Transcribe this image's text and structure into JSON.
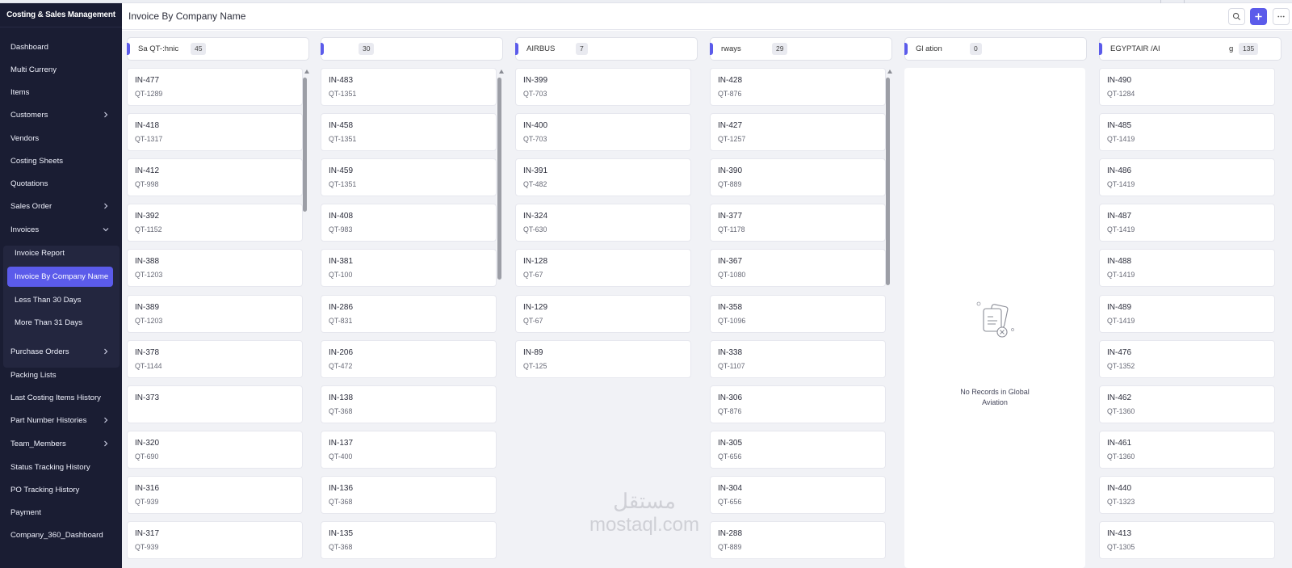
{
  "app": {
    "title": "Costing & Sales Management",
    "accent_color": "#5b5bea",
    "sidebar_bg": "#1a1d33"
  },
  "sidebar": {
    "items": [
      {
        "label": "Dashboard"
      },
      {
        "label": "Multi Curreny"
      },
      {
        "label": "Items"
      },
      {
        "label": "Customers",
        "expandable": true
      },
      {
        "label": "Vendors"
      },
      {
        "label": "Costing Sheets"
      },
      {
        "label": "Quotations"
      },
      {
        "label": "Sales Order",
        "expandable": true
      },
      {
        "label": "Invoices",
        "expandable": true,
        "expanded": true
      },
      {
        "label": "Purchase Orders",
        "expandable": true
      },
      {
        "label": "Packing Lists"
      },
      {
        "label": "Last Costing Items History"
      },
      {
        "label": "Part Number Histories",
        "expandable": true
      },
      {
        "label": "Team_Members",
        "expandable": true
      },
      {
        "label": "Status Tracking History"
      },
      {
        "label": "PO Tracking History"
      },
      {
        "label": "Payment"
      },
      {
        "label": "Company_360_Dashboard"
      }
    ],
    "invoice_subitems": [
      {
        "label": "Invoice Report"
      },
      {
        "label": "Invoice By Company Name",
        "active": true
      },
      {
        "label": "Less Than 30 Days"
      },
      {
        "label": "More Than 31 Days"
      }
    ]
  },
  "header": {
    "title": "Invoice By Company Name",
    "search_icon": "search-icon",
    "add_icon": "plus-icon",
    "more_icon": "ellipsis-icon"
  },
  "board": {
    "columns": [
      {
        "name": "Sa      QT-:hnic",
        "count": "45",
        "cards": [
          {
            "inv": "IN-477",
            "qt": "QT-1289"
          },
          {
            "inv": "IN-418",
            "qt": "QT-1317"
          },
          {
            "inv": "IN-412",
            "qt": "QT-998"
          },
          {
            "inv": "IN-392",
            "qt": "QT-1152"
          },
          {
            "inv": "IN-388",
            "qt": "QT-1203"
          },
          {
            "inv": "IN-389",
            "qt": "QT-1203"
          },
          {
            "inv": "IN-378",
            "qt": "QT-1144"
          },
          {
            "inv": "IN-373",
            "qt": ""
          },
          {
            "inv": "IN-320",
            "qt": "QT-690"
          },
          {
            "inv": "IN-316",
            "qt": "QT-939"
          },
          {
            "inv": "IN-317",
            "qt": "QT-939"
          }
        ]
      },
      {
        "name": "",
        "count": "30",
        "cards": [
          {
            "inv": "IN-483",
            "qt": "QT-1351"
          },
          {
            "inv": "IN-458",
            "qt": "QT-1351"
          },
          {
            "inv": "IN-459",
            "qt": "QT-1351"
          },
          {
            "inv": "IN-408",
            "qt": "QT-983"
          },
          {
            "inv": "IN-381",
            "qt": "QT-100"
          },
          {
            "inv": "IN-286",
            "qt": "QT-831"
          },
          {
            "inv": "IN-206",
            "qt": "QT-472"
          },
          {
            "inv": "IN-138",
            "qt": "QT-368"
          },
          {
            "inv": "IN-137",
            "qt": "QT-400"
          },
          {
            "inv": "IN-136",
            "qt": "QT-368"
          },
          {
            "inv": "IN-135",
            "qt": "QT-368"
          }
        ]
      },
      {
        "name": "AIRBUS",
        "count": "7",
        "cards": [
          {
            "inv": "IN-399",
            "qt": "QT-703"
          },
          {
            "inv": "IN-400",
            "qt": "QT-703"
          },
          {
            "inv": "IN-391",
            "qt": "QT-482"
          },
          {
            "inv": "IN-324",
            "qt": "QT-630"
          },
          {
            "inv": "IN-128",
            "qt": "QT-67"
          },
          {
            "inv": "IN-129",
            "qt": "QT-67"
          },
          {
            "inv": "IN-89",
            "qt": "QT-125"
          }
        ]
      },
      {
        "name": "rways",
        "count": "29",
        "cards": [
          {
            "inv": "IN-428",
            "qt": "QT-876"
          },
          {
            "inv": "IN-427",
            "qt": "QT-1257"
          },
          {
            "inv": "IN-390",
            "qt": "QT-889"
          },
          {
            "inv": "IN-377",
            "qt": "QT-1178"
          },
          {
            "inv": "IN-367",
            "qt": "QT-1080"
          },
          {
            "inv": "IN-358",
            "qt": "QT-1096"
          },
          {
            "inv": "IN-338",
            "qt": "QT-1107"
          },
          {
            "inv": "IN-306",
            "qt": "QT-876"
          },
          {
            "inv": "IN-305",
            "qt": "QT-656"
          },
          {
            "inv": "IN-304",
            "qt": "QT-656"
          },
          {
            "inv": "IN-288",
            "qt": "QT-889"
          }
        ]
      },
      {
        "name": "Gl        ation",
        "count": "0",
        "cards": [],
        "empty_text": "No Records in Global\nAviation"
      },
      {
        "name": "EGYPTAIR /AI",
        "name_tail": "g",
        "count": "135",
        "cards": [
          {
            "inv": "IN-490",
            "qt": "QT-1284"
          },
          {
            "inv": "IN-485",
            "qt": "QT-1419"
          },
          {
            "inv": "IN-486",
            "qt": "QT-1419"
          },
          {
            "inv": "IN-487",
            "qt": "QT-1419"
          },
          {
            "inv": "IN-488",
            "qt": "QT-1419"
          },
          {
            "inv": "IN-489",
            "qt": "QT-1419"
          },
          {
            "inv": "IN-476",
            "qt": "QT-1352"
          },
          {
            "inv": "IN-462",
            "qt": "QT-1360"
          },
          {
            "inv": "IN-461",
            "qt": "QT-1360"
          },
          {
            "inv": "IN-440",
            "qt": "QT-1323"
          },
          {
            "inv": "IN-413",
            "qt": "QT-1305"
          }
        ]
      }
    ]
  },
  "watermark": {
    "line1": "مستقل",
    "line2": "mostaql.com"
  }
}
